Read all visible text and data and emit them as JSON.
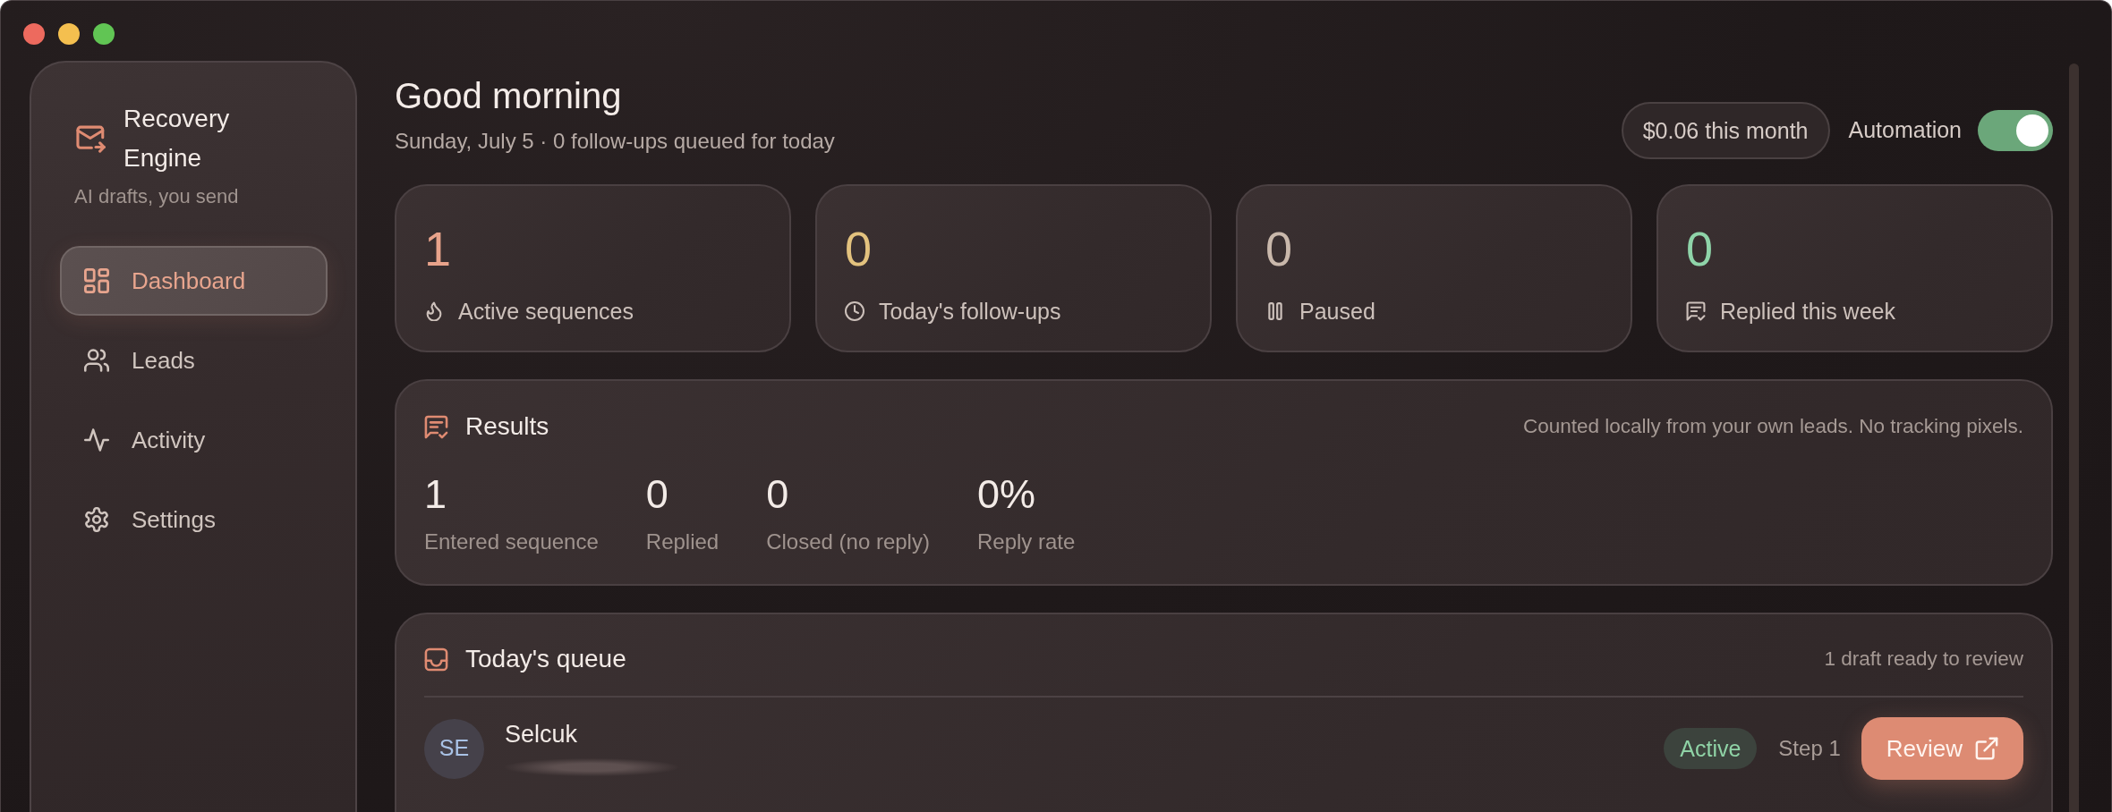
{
  "sidebar": {
    "app_name": "Recovery Engine",
    "tagline": "AI drafts, you send",
    "items": [
      {
        "label": "Dashboard",
        "selected": true
      },
      {
        "label": "Leads",
        "selected": false
      },
      {
        "label": "Activity",
        "selected": false
      },
      {
        "label": "Settings",
        "selected": false
      }
    ]
  },
  "header": {
    "greeting": "Good morning",
    "subtitle": "Sunday, July 5 · 0 follow-ups queued for today",
    "spend": "$0.06 this month",
    "automation": {
      "label": "Automation",
      "on": true
    }
  },
  "stats": [
    {
      "value": "1",
      "label": "Active sequences",
      "color": "#e8a38b"
    },
    {
      "value": "0",
      "label": "Today's follow-ups",
      "color": "#e3c27e"
    },
    {
      "value": "0",
      "label": "Paused",
      "color": "#c9b8ab"
    },
    {
      "value": "0",
      "label": "Replied this week",
      "color": "#8fd4a9"
    }
  ],
  "results": {
    "title": "Results",
    "note": "Counted locally from your own leads. No tracking pixels.",
    "metrics": [
      {
        "value": "1",
        "label": "Entered sequence"
      },
      {
        "value": "0",
        "label": "Replied"
      },
      {
        "value": "0",
        "label": "Closed (no reply)"
      },
      {
        "value": "0%",
        "label": "Reply rate"
      }
    ]
  },
  "queue": {
    "title": "Today's queue",
    "summary": "1 draft ready to review",
    "items": [
      {
        "initials": "SE",
        "name": "Selcuk",
        "status": "Active",
        "step": "Step 1",
        "action": "Review"
      }
    ]
  }
}
